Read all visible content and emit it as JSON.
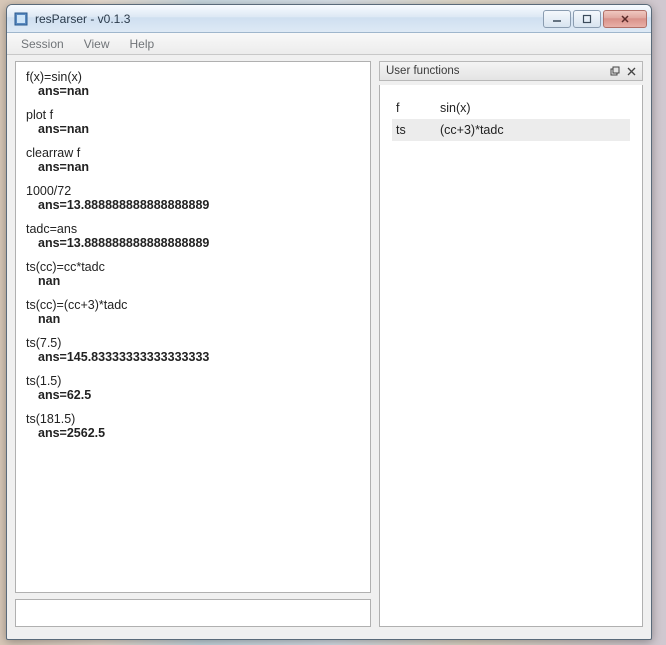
{
  "window": {
    "title": "resParser - v0.1.3"
  },
  "menubar": {
    "items": [
      "Session",
      "View",
      "Help"
    ]
  },
  "console": {
    "entries": [
      {
        "input": "f(x)=sin(x)",
        "result": "ans=nan"
      },
      {
        "input": "plot f",
        "result": "ans=nan"
      },
      {
        "input": "clearraw f",
        "result": "ans=nan"
      },
      {
        "input": "1000/72",
        "result": "ans=13.888888888888888889"
      },
      {
        "input": "tadc=ans",
        "result": "ans=13.888888888888888889"
      },
      {
        "input": "ts(cc)=cc*tadc",
        "result": "nan"
      },
      {
        "input": "ts(cc)=(cc+3)*tadc",
        "result": "nan"
      },
      {
        "input": "ts(7.5)",
        "result": "ans=145.83333333333333333"
      },
      {
        "input": "ts(1.5)",
        "result": "ans=62.5"
      },
      {
        "input": "ts(181.5)",
        "result": "ans=2562.5"
      }
    ],
    "input_value": ""
  },
  "user_functions": {
    "title": "User functions",
    "rows": [
      {
        "name": "f",
        "def": "sin(x)"
      },
      {
        "name": "ts",
        "def": "(cc+3)*tadc"
      }
    ]
  }
}
